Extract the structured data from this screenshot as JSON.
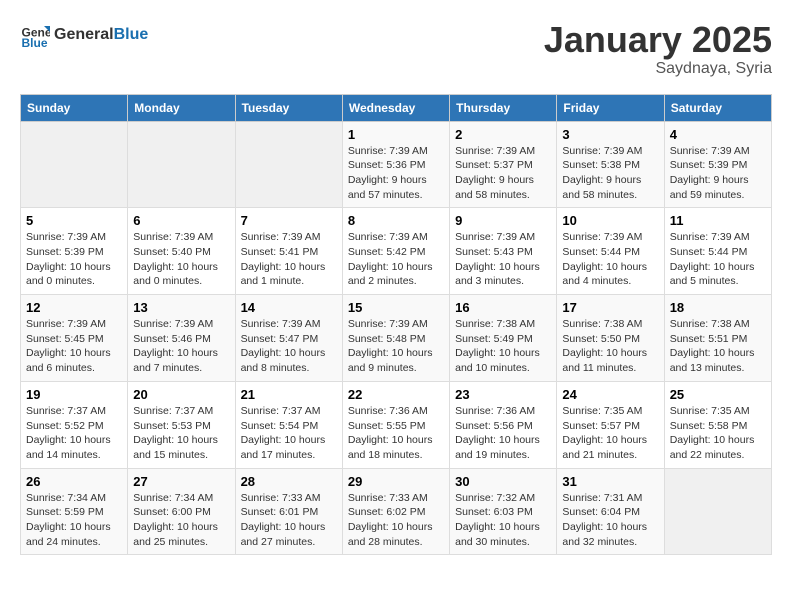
{
  "header": {
    "logo_general": "General",
    "logo_blue": "Blue",
    "month_title": "January 2025",
    "subtitle": "Saydnaya, Syria"
  },
  "weekdays": [
    "Sunday",
    "Monday",
    "Tuesday",
    "Wednesday",
    "Thursday",
    "Friday",
    "Saturday"
  ],
  "weeks": [
    [
      {
        "day": "",
        "info": ""
      },
      {
        "day": "",
        "info": ""
      },
      {
        "day": "",
        "info": ""
      },
      {
        "day": "1",
        "info": "Sunrise: 7:39 AM\nSunset: 5:36 PM\nDaylight: 9 hours\nand 57 minutes."
      },
      {
        "day": "2",
        "info": "Sunrise: 7:39 AM\nSunset: 5:37 PM\nDaylight: 9 hours\nand 58 minutes."
      },
      {
        "day": "3",
        "info": "Sunrise: 7:39 AM\nSunset: 5:38 PM\nDaylight: 9 hours\nand 58 minutes."
      },
      {
        "day": "4",
        "info": "Sunrise: 7:39 AM\nSunset: 5:39 PM\nDaylight: 9 hours\nand 59 minutes."
      }
    ],
    [
      {
        "day": "5",
        "info": "Sunrise: 7:39 AM\nSunset: 5:39 PM\nDaylight: 10 hours\nand 0 minutes."
      },
      {
        "day": "6",
        "info": "Sunrise: 7:39 AM\nSunset: 5:40 PM\nDaylight: 10 hours\nand 0 minutes."
      },
      {
        "day": "7",
        "info": "Sunrise: 7:39 AM\nSunset: 5:41 PM\nDaylight: 10 hours\nand 1 minute."
      },
      {
        "day": "8",
        "info": "Sunrise: 7:39 AM\nSunset: 5:42 PM\nDaylight: 10 hours\nand 2 minutes."
      },
      {
        "day": "9",
        "info": "Sunrise: 7:39 AM\nSunset: 5:43 PM\nDaylight: 10 hours\nand 3 minutes."
      },
      {
        "day": "10",
        "info": "Sunrise: 7:39 AM\nSunset: 5:44 PM\nDaylight: 10 hours\nand 4 minutes."
      },
      {
        "day": "11",
        "info": "Sunrise: 7:39 AM\nSunset: 5:44 PM\nDaylight: 10 hours\nand 5 minutes."
      }
    ],
    [
      {
        "day": "12",
        "info": "Sunrise: 7:39 AM\nSunset: 5:45 PM\nDaylight: 10 hours\nand 6 minutes."
      },
      {
        "day": "13",
        "info": "Sunrise: 7:39 AM\nSunset: 5:46 PM\nDaylight: 10 hours\nand 7 minutes."
      },
      {
        "day": "14",
        "info": "Sunrise: 7:39 AM\nSunset: 5:47 PM\nDaylight: 10 hours\nand 8 minutes."
      },
      {
        "day": "15",
        "info": "Sunrise: 7:39 AM\nSunset: 5:48 PM\nDaylight: 10 hours\nand 9 minutes."
      },
      {
        "day": "16",
        "info": "Sunrise: 7:38 AM\nSunset: 5:49 PM\nDaylight: 10 hours\nand 10 minutes."
      },
      {
        "day": "17",
        "info": "Sunrise: 7:38 AM\nSunset: 5:50 PM\nDaylight: 10 hours\nand 11 minutes."
      },
      {
        "day": "18",
        "info": "Sunrise: 7:38 AM\nSunset: 5:51 PM\nDaylight: 10 hours\nand 13 minutes."
      }
    ],
    [
      {
        "day": "19",
        "info": "Sunrise: 7:37 AM\nSunset: 5:52 PM\nDaylight: 10 hours\nand 14 minutes."
      },
      {
        "day": "20",
        "info": "Sunrise: 7:37 AM\nSunset: 5:53 PM\nDaylight: 10 hours\nand 15 minutes."
      },
      {
        "day": "21",
        "info": "Sunrise: 7:37 AM\nSunset: 5:54 PM\nDaylight: 10 hours\nand 17 minutes."
      },
      {
        "day": "22",
        "info": "Sunrise: 7:36 AM\nSunset: 5:55 PM\nDaylight: 10 hours\nand 18 minutes."
      },
      {
        "day": "23",
        "info": "Sunrise: 7:36 AM\nSunset: 5:56 PM\nDaylight: 10 hours\nand 19 minutes."
      },
      {
        "day": "24",
        "info": "Sunrise: 7:35 AM\nSunset: 5:57 PM\nDaylight: 10 hours\nand 21 minutes."
      },
      {
        "day": "25",
        "info": "Sunrise: 7:35 AM\nSunset: 5:58 PM\nDaylight: 10 hours\nand 22 minutes."
      }
    ],
    [
      {
        "day": "26",
        "info": "Sunrise: 7:34 AM\nSunset: 5:59 PM\nDaylight: 10 hours\nand 24 minutes."
      },
      {
        "day": "27",
        "info": "Sunrise: 7:34 AM\nSunset: 6:00 PM\nDaylight: 10 hours\nand 25 minutes."
      },
      {
        "day": "28",
        "info": "Sunrise: 7:33 AM\nSunset: 6:01 PM\nDaylight: 10 hours\nand 27 minutes."
      },
      {
        "day": "29",
        "info": "Sunrise: 7:33 AM\nSunset: 6:02 PM\nDaylight: 10 hours\nand 28 minutes."
      },
      {
        "day": "30",
        "info": "Sunrise: 7:32 AM\nSunset: 6:03 PM\nDaylight: 10 hours\nand 30 minutes."
      },
      {
        "day": "31",
        "info": "Sunrise: 7:31 AM\nSunset: 6:04 PM\nDaylight: 10 hours\nand 32 minutes."
      },
      {
        "day": "",
        "info": ""
      }
    ]
  ]
}
